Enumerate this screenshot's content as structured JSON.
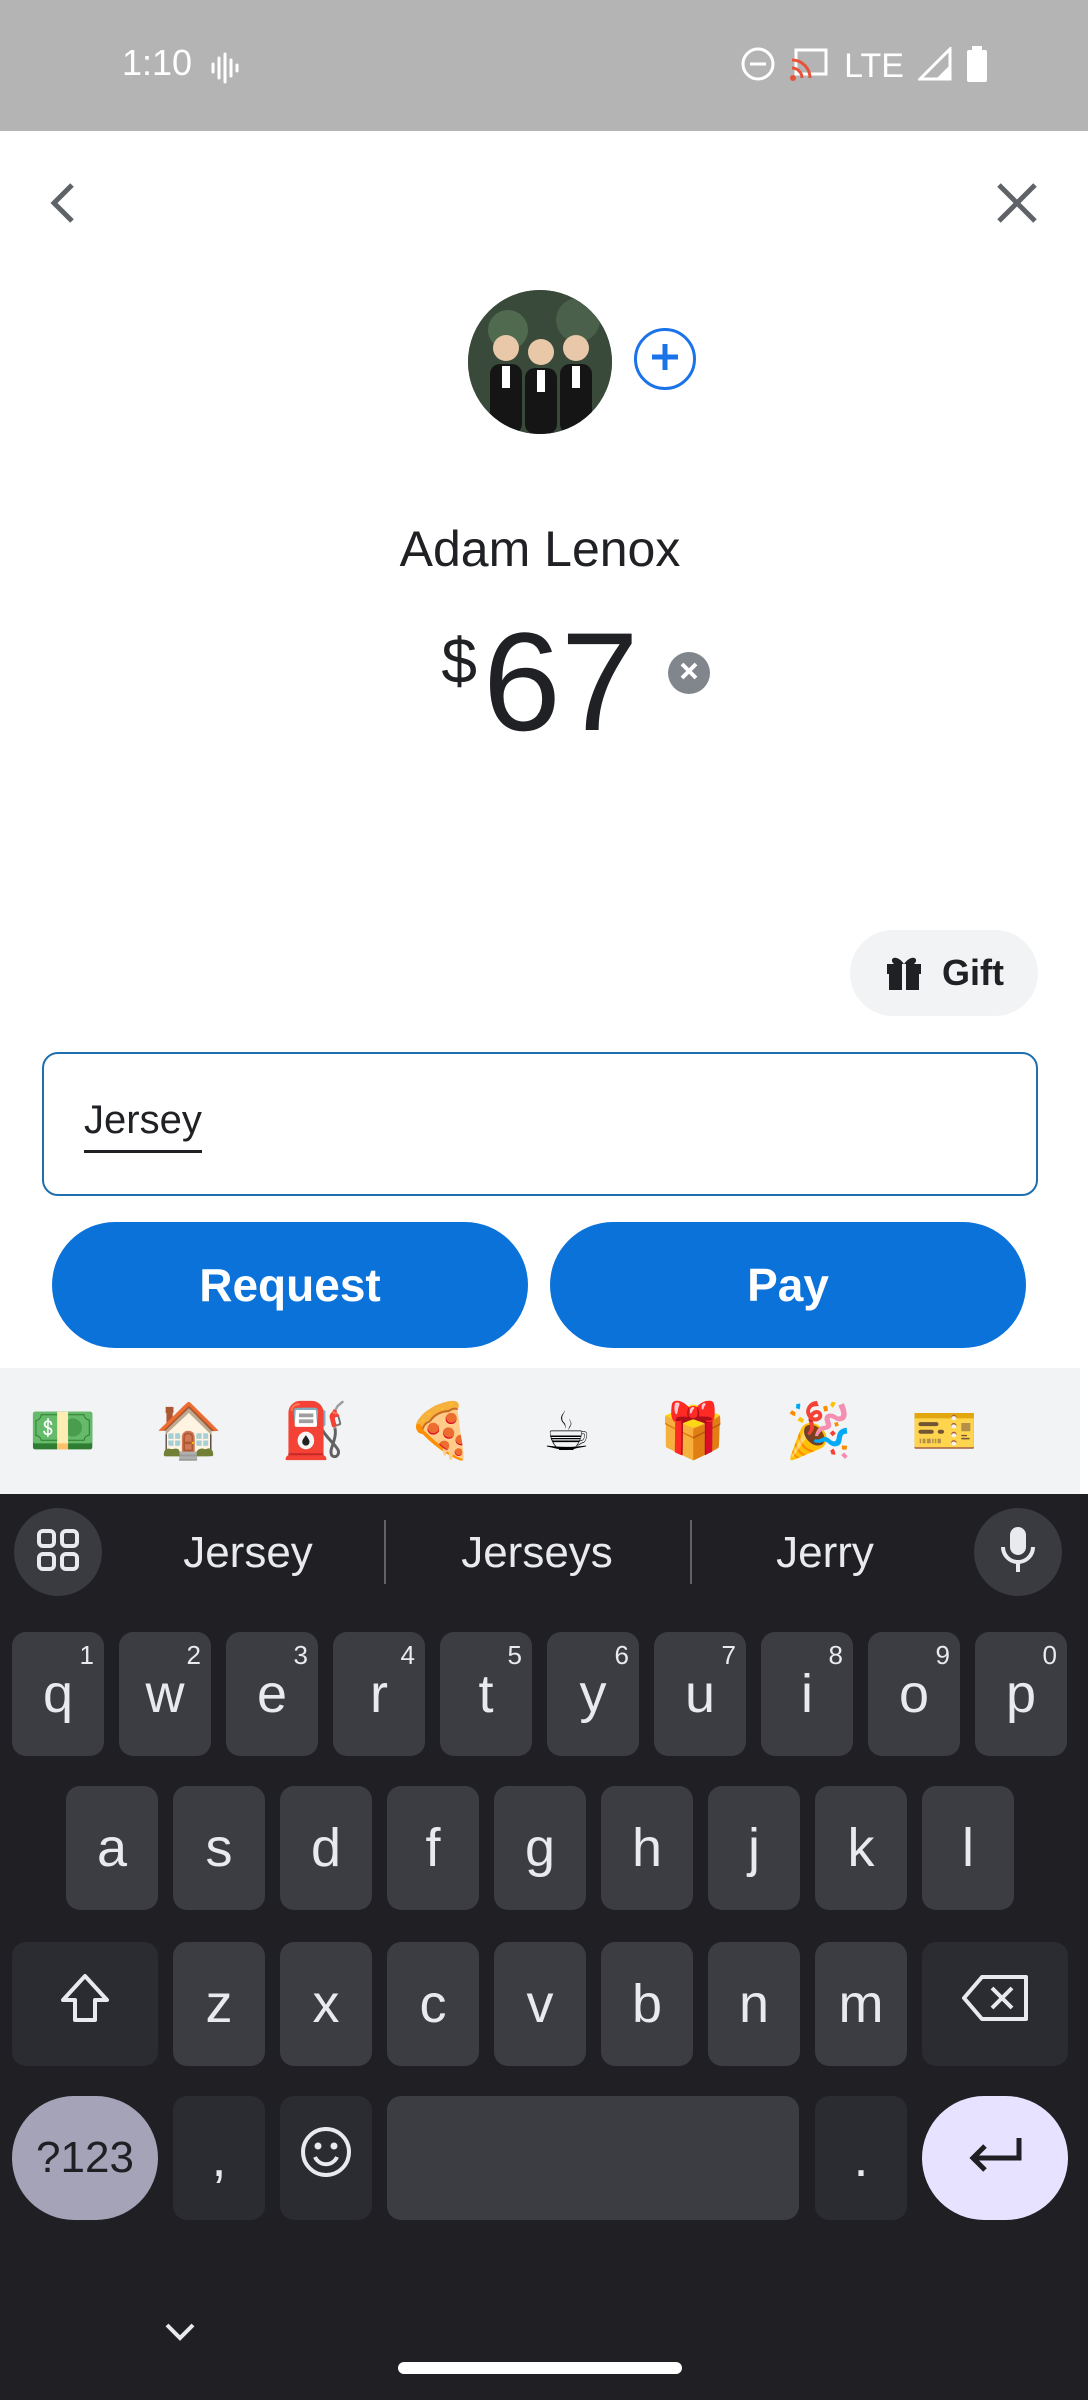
{
  "status_bar": {
    "time": "1:10",
    "network": "LTE"
  },
  "header": {
    "back_icon": "chevron-left-icon",
    "close_icon": "close-icon"
  },
  "recipient": {
    "name": "Adam Lenox",
    "avatar_icon": "avatar",
    "add_icon": "plus-icon"
  },
  "payment": {
    "currency": "$",
    "amount": "67"
  },
  "gift": {
    "label": "Gift"
  },
  "note": {
    "value": "Jersey"
  },
  "actions": {
    "request_label": "Request",
    "pay_label": "Pay"
  },
  "emoji_bar": [
    "💵",
    "🏠",
    "⛽",
    "🍕",
    "☕",
    "🎁",
    "🎉",
    "🎫"
  ],
  "keyboard": {
    "suggestions": [
      "Jersey",
      "Jerseys",
      "Jerry"
    ],
    "row1": [
      {
        "k": "q",
        "n": "1"
      },
      {
        "k": "w",
        "n": "2"
      },
      {
        "k": "e",
        "n": "3"
      },
      {
        "k": "r",
        "n": "4"
      },
      {
        "k": "t",
        "n": "5"
      },
      {
        "k": "y",
        "n": "6"
      },
      {
        "k": "u",
        "n": "7"
      },
      {
        "k": "i",
        "n": "8"
      },
      {
        "k": "o",
        "n": "9"
      },
      {
        "k": "p",
        "n": "0"
      }
    ],
    "row2": [
      "a",
      "s",
      "d",
      "f",
      "g",
      "h",
      "j",
      "k",
      "l"
    ],
    "row3": [
      "z",
      "x",
      "c",
      "v",
      "b",
      "n",
      "m"
    ],
    "symbols_key": "?123",
    "comma_key": ",",
    "period_key": "."
  },
  "colors": {
    "accent": "#0b72d9",
    "status_bar": "#b4b4b4",
    "keyboard_bg": "#1f1f24"
  }
}
